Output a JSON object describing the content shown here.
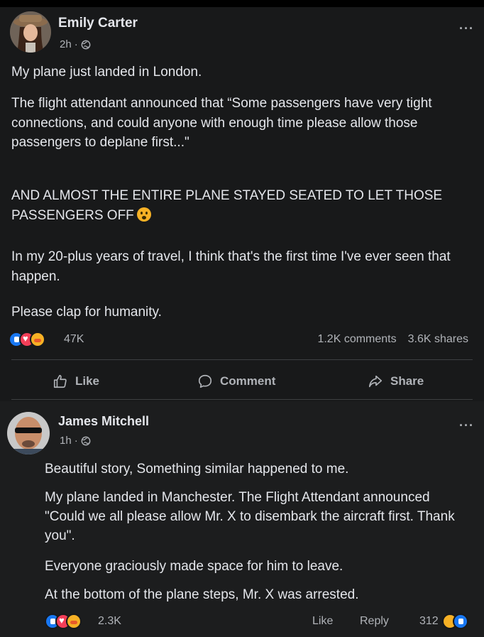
{
  "post": {
    "author": "Emily Carter",
    "time": "2h",
    "separator": "·",
    "paragraphs": [
      "My plane just landed in London.",
      "The flight attendant announced that “Some passengers have very tight connections, and could anyone with enough time please allow those passengers to deplane first...\"",
      "AND ALMOST THE ENTIRE PLANE STAYED SEATED TO LET THOSE PASSENGERS OFF",
      "In my 20-plus years of travel, I think that's the first time I've ever seen that happen.",
      "Please clap for humanity."
    ],
    "reaction_count": "47K",
    "comments": "1.2K comments",
    "shares": "3.6K shares",
    "more": "···"
  },
  "actions": {
    "like": "Like",
    "comment": "Comment",
    "share": "Share"
  },
  "comment": {
    "author": "James Mitchell",
    "time": "1h",
    "separator": "·",
    "paragraphs": [
      "Beautiful story, Something similar happened to me.",
      "My plane landed in Manchester. The Flight Attendant announced \"Could we all please allow Mr. X to disembark the aircraft first. Thank you\".",
      "Everyone graciously made space for him to leave.",
      "At the bottom of the plane steps, Mr. X was arrested."
    ],
    "reaction_count": "2.3K",
    "like": "Like",
    "reply": "Reply",
    "reply_reactions": "312",
    "more": "···"
  },
  "colors": {
    "background": "#18191a",
    "text": "#e4e6eb",
    "secondary": "#b0b3b8",
    "like_blue": "#1877f2",
    "love_red": "#f33e58",
    "emoji_yellow": "#f7b125"
  },
  "icons": [
    "globe-icon",
    "like-icon",
    "comment-icon",
    "share-icon",
    "more-icon"
  ]
}
